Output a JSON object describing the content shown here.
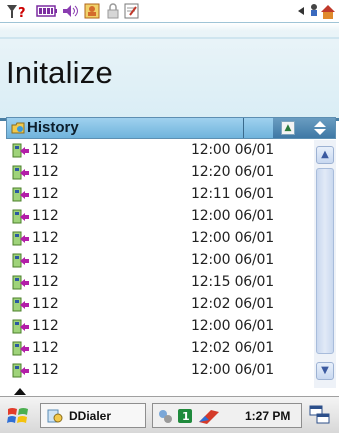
{
  "status_bar": {
    "icons": [
      "signal-unknown-icon",
      "battery-icon",
      "volume-icon",
      "contacts-icon",
      "lock-icon",
      "notes-icon"
    ],
    "right_icons": [
      "back-arrow-icon",
      "network-icon"
    ]
  },
  "title": "Initalize",
  "history": {
    "label": "History",
    "rows": [
      {
        "number": "112",
        "time": "12:00 06/01"
      },
      {
        "number": "112",
        "time": "12:20 06/01"
      },
      {
        "number": "112",
        "time": "12:11 06/01"
      },
      {
        "number": "112",
        "time": "12:00 06/01"
      },
      {
        "number": "112",
        "time": "12:00 06/01"
      },
      {
        "number": "112",
        "time": "12:00 06/01"
      },
      {
        "number": "112",
        "time": "12:15 06/01"
      },
      {
        "number": "112",
        "time": "12:02 06/01"
      },
      {
        "number": "112",
        "time": "12:00 06/01"
      },
      {
        "number": "112",
        "time": "12:02 06/01"
      },
      {
        "number": "112",
        "time": "12:00 06/01"
      }
    ]
  },
  "taskbar": {
    "app_label": "DDialer",
    "clock": "1:27 PM"
  },
  "colors": {
    "header_blue": "#6fb3dc",
    "title_bg": "#d9edf5",
    "accent_dark": "#4a7fa3"
  }
}
